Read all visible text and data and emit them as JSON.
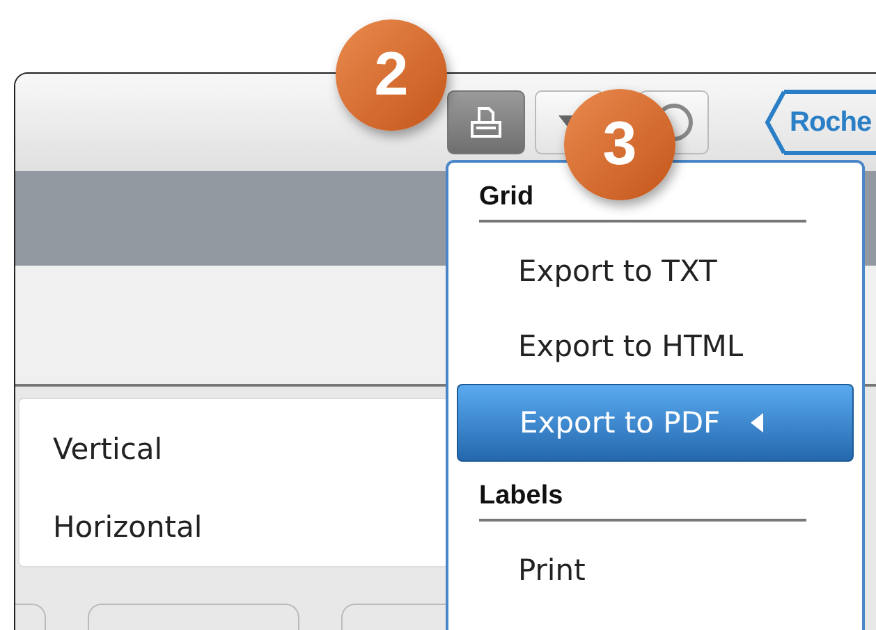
{
  "toolbar": {
    "buttons": [
      {
        "kind": "print",
        "selected": true
      },
      {
        "kind": "dropdown",
        "selected": false
      },
      {
        "kind": "help",
        "selected": false
      }
    ],
    "logo": "Roche"
  },
  "orientation_list": [
    "Vertical",
    "Horizontal"
  ],
  "menu": {
    "sections": [
      {
        "title": "Grid",
        "items": [
          {
            "label": "Export to TXT",
            "selected": false
          },
          {
            "label": "Export to HTML",
            "selected": false
          },
          {
            "label": "Export to PDF",
            "selected": true
          }
        ]
      },
      {
        "title": "Labels",
        "items": [
          {
            "label": "Print",
            "selected": false
          }
        ]
      }
    ]
  },
  "callouts": [
    {
      "number": "2"
    },
    {
      "number": "3"
    }
  ]
}
